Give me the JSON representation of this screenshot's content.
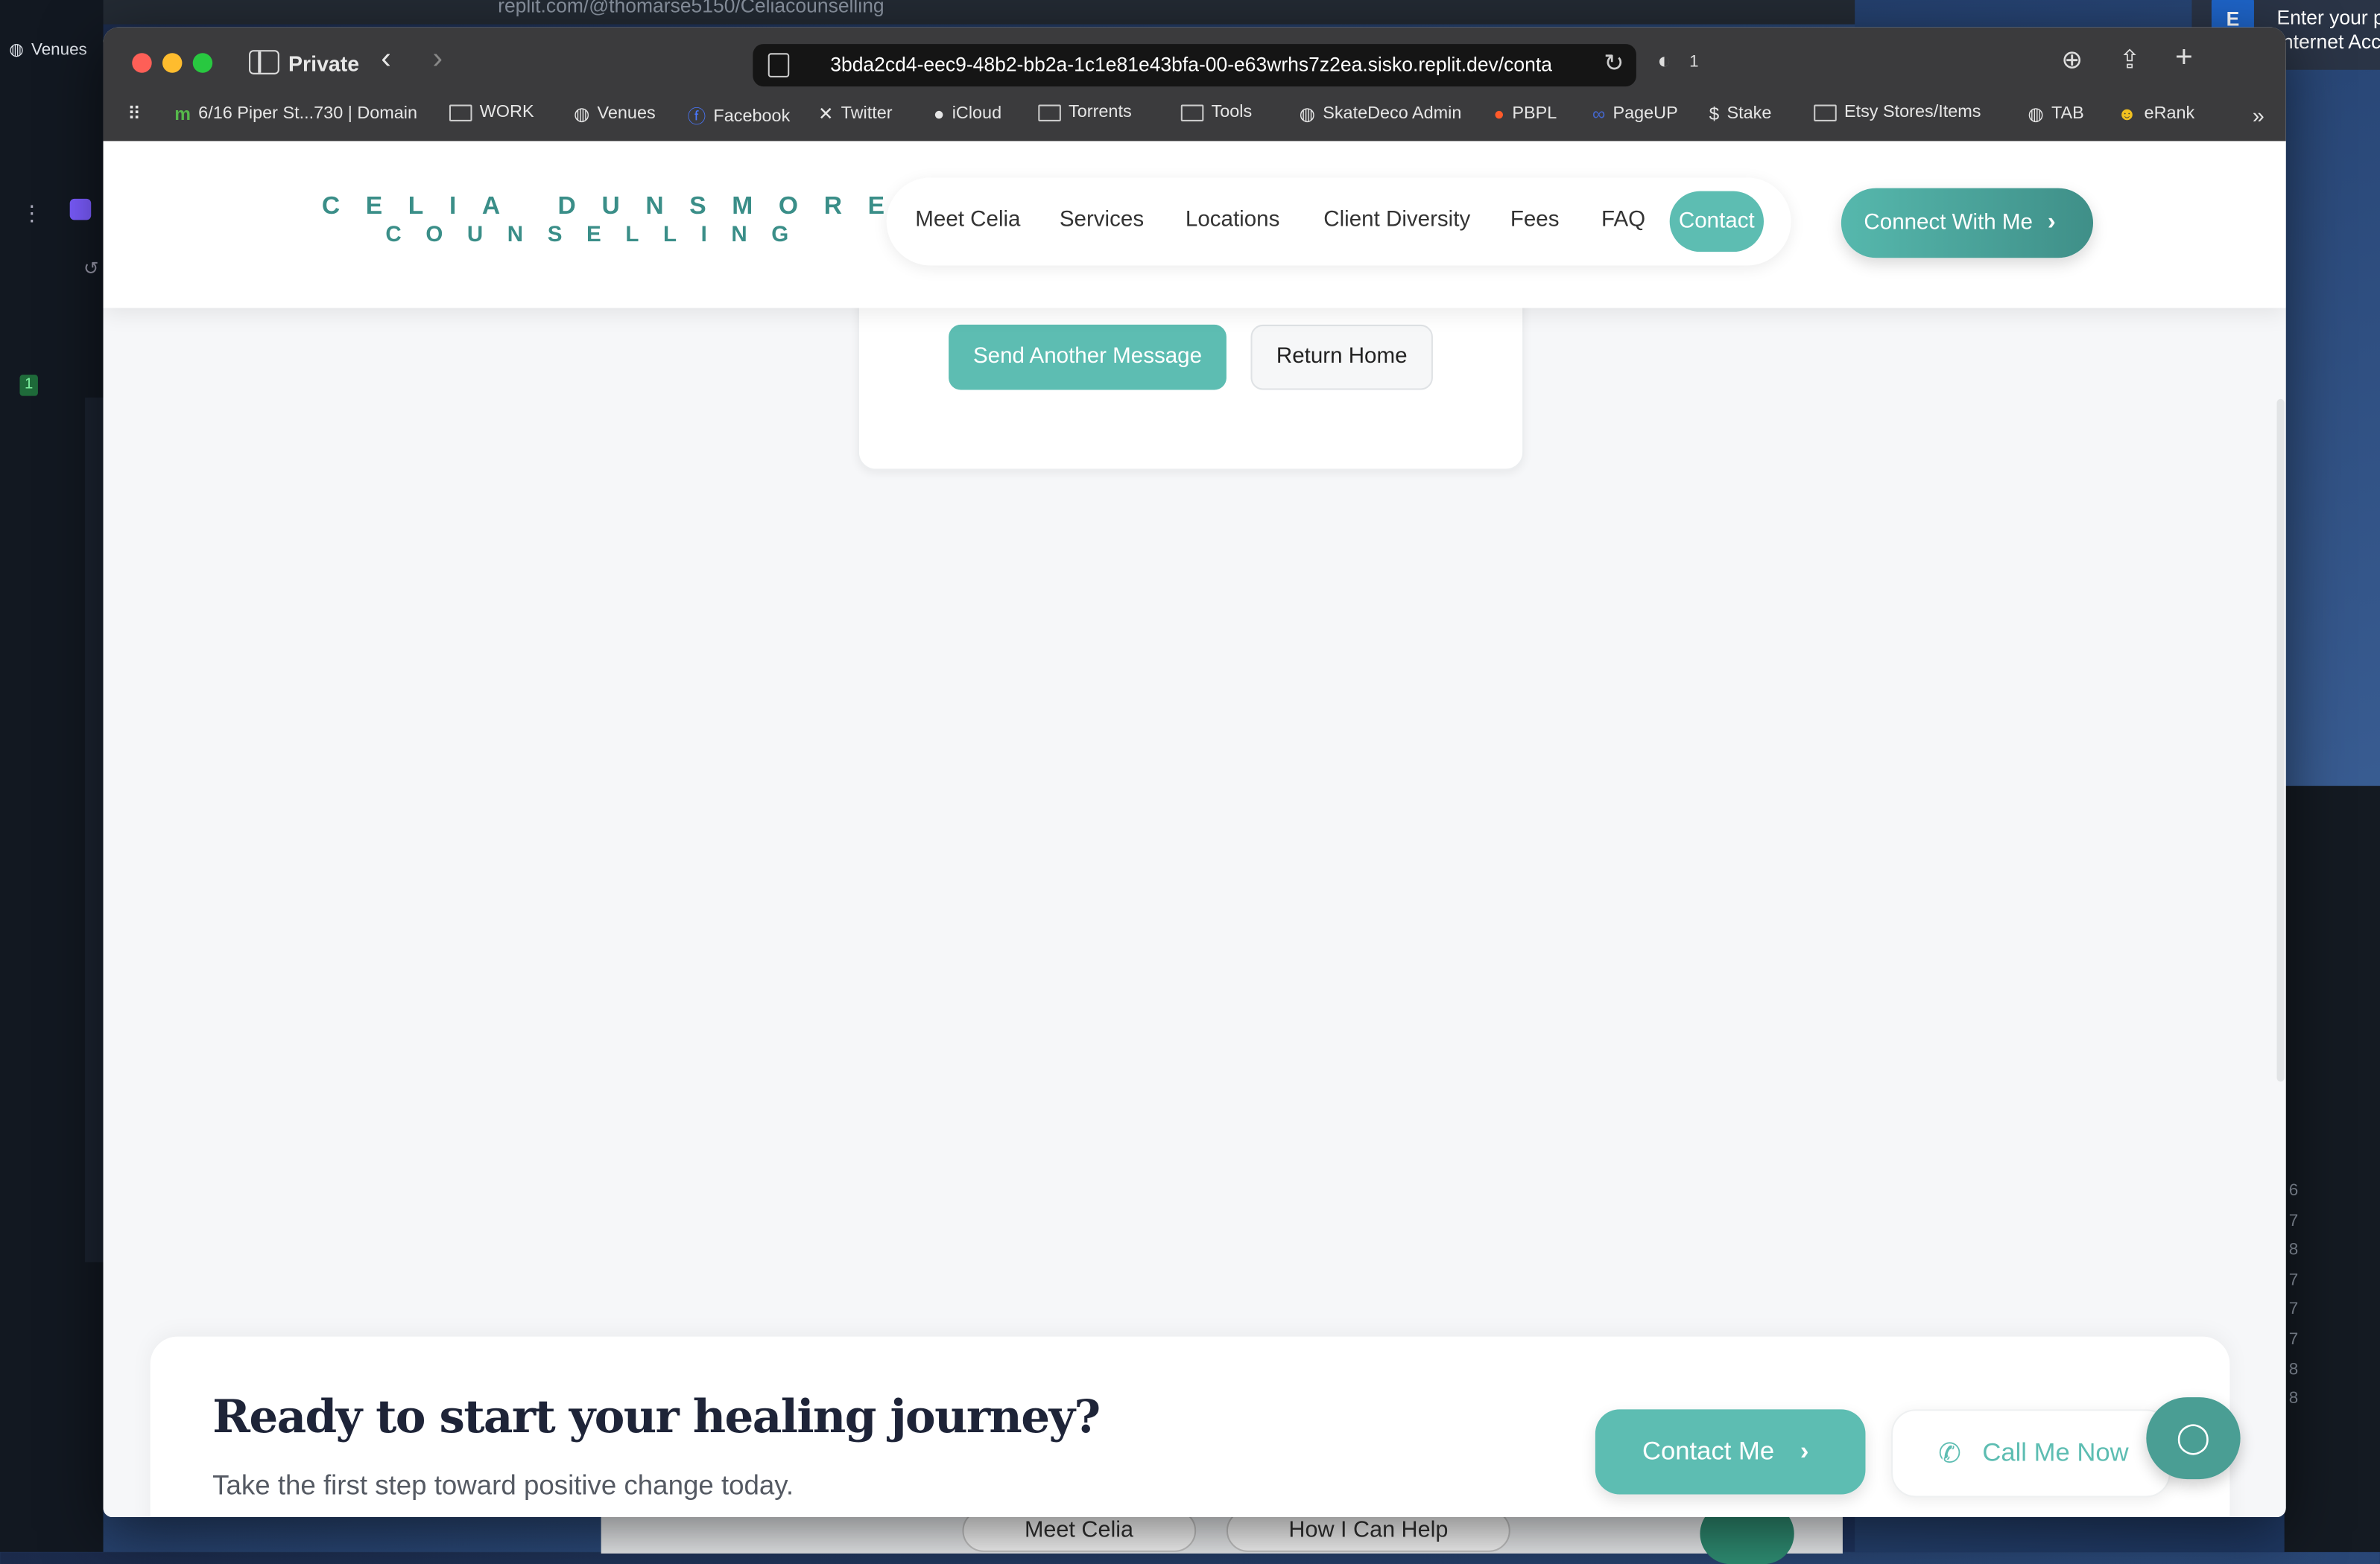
{
  "desktop": {
    "left_label": "Venues",
    "background_tab_url": "replit.com/@thomarse5150/Celiacounselling",
    "badge_count": "1",
    "notification": {
      "line1": "Enter your p",
      "line2": "Internet Acc"
    },
    "right_numbers": [
      "6",
      "7",
      "8",
      "7",
      "7",
      "7",
      "8",
      "8"
    ],
    "background_pills": [
      "Meet Celia",
      "How I Can Help"
    ]
  },
  "browser": {
    "mode_label": "Private",
    "url": "3bda2cd4-eec9-48b2-bb2a-1c1e81e43bfa-00-e63wrhs7z2ea.sisko.replit.dev/conta",
    "shield_count": "1",
    "bookmarks": [
      {
        "label": "6/16 Piper St...730 | Domain",
        "icon": "domain-icon"
      },
      {
        "label": "WORK",
        "icon": "folder-icon"
      },
      {
        "label": "Venues",
        "icon": "globe-icon"
      },
      {
        "label": "Facebook",
        "icon": "facebook-icon"
      },
      {
        "label": "Twitter",
        "icon": "x-icon"
      },
      {
        "label": "iCloud",
        "icon": "apple-icon"
      },
      {
        "label": "Torrents",
        "icon": "folder-icon"
      },
      {
        "label": "Tools",
        "icon": "folder-icon"
      },
      {
        "label": "SkateDeco Admin",
        "icon": "globe-icon"
      },
      {
        "label": "PBPL",
        "icon": "reddit-icon"
      },
      {
        "label": "PageUP",
        "icon": "pageup-icon"
      },
      {
        "label": "Stake",
        "icon": "stake-icon"
      },
      {
        "label": "Etsy Stores/Items",
        "icon": "folder-icon"
      },
      {
        "label": "TAB",
        "icon": "globe-icon"
      },
      {
        "label": "eRank",
        "icon": "erank-icon"
      }
    ]
  },
  "site": {
    "logo_line1": "CELIA DUNSMORE",
    "logo_line2": "COUNSELLING",
    "nav": [
      "Meet Celia",
      "Services",
      "Locations",
      "Client Diversity",
      "Fees",
      "FAQ",
      "Contact"
    ],
    "active_nav": "Contact",
    "connect_label": "Connect With Me",
    "accent": "#5dbdb2",
    "card": {
      "send_another": "Send Another Message",
      "return_home": "Return Home"
    },
    "cta": {
      "title": "Ready to start your healing journey?",
      "subtitle": "Take the first step toward positive change today.",
      "contact_label": "Contact Me",
      "call_label": "Call Me Now"
    }
  }
}
